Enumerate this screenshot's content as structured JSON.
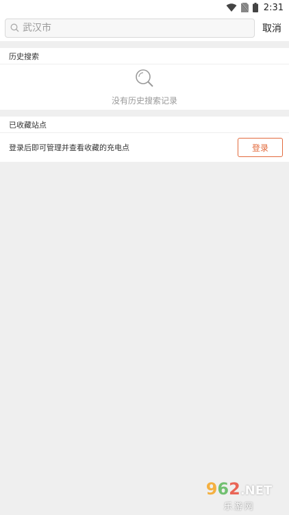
{
  "status_bar": {
    "time": "2:31"
  },
  "search": {
    "placeholder": "武汉市",
    "cancel_label": "取消"
  },
  "history": {
    "title": "历史搜索",
    "empty_text": "没有历史搜索记录"
  },
  "favorites": {
    "title": "已收藏站点",
    "hint": "登录后即可管理并查看收藏的充电点",
    "login_label": "登录"
  },
  "watermark": {
    "number_1": "9",
    "number_2": "6",
    "number_3": "2",
    "suffix": ".NET",
    "site_name": "乐游网"
  },
  "colors": {
    "accent": "#e2683a",
    "background": "#efefef"
  }
}
